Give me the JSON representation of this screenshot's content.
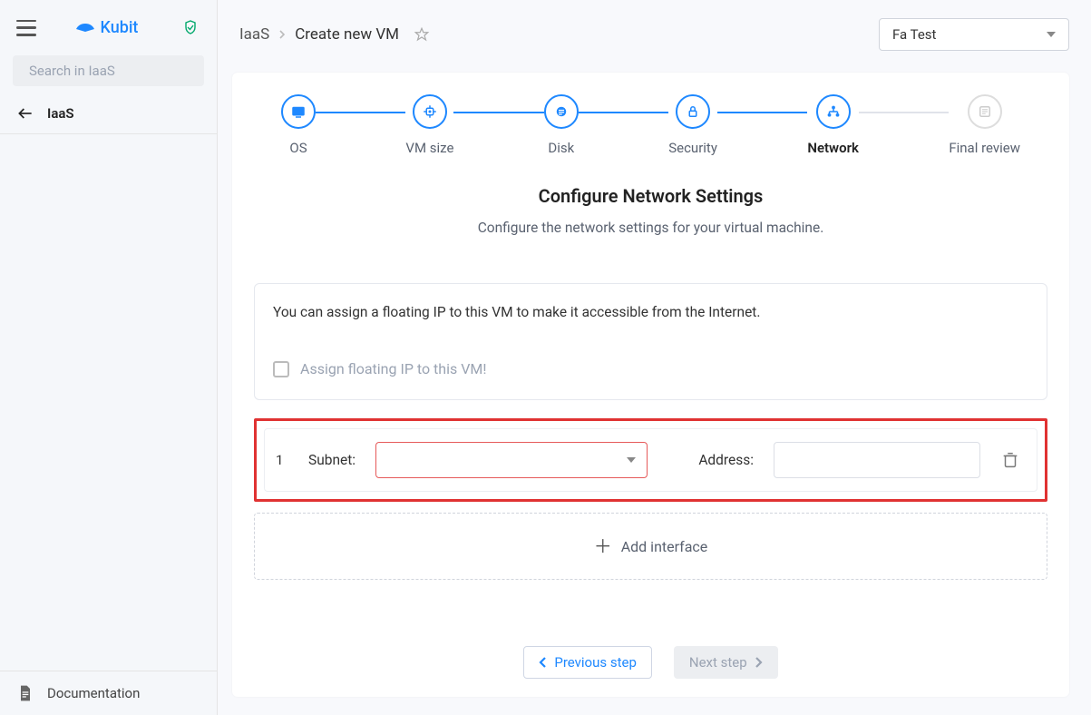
{
  "brand": {
    "name": "Kubit"
  },
  "search": {
    "placeholder": "Search in IaaS"
  },
  "nav": {
    "back_label": "IaaS"
  },
  "sidebar": {
    "documentation": "Documentation"
  },
  "breadcrumb": {
    "root": "IaaS",
    "current": "Create new VM"
  },
  "project_select": {
    "value": "Fa Test"
  },
  "stepper": {
    "steps": [
      {
        "label": "OS"
      },
      {
        "label": "VM size"
      },
      {
        "label": "Disk"
      },
      {
        "label": "Security"
      },
      {
        "label": "Network"
      },
      {
        "label": "Final review"
      }
    ]
  },
  "page": {
    "title": "Configure Network Settings",
    "subtitle": "Configure the network settings for your virtual machine."
  },
  "floating_ip": {
    "info": "You can assign a floating IP to this VM to make it accessible from the Internet.",
    "checkbox_label": "Assign floating IP to this VM!"
  },
  "interface": {
    "index": "1",
    "subnet_label": "Subnet:",
    "address_label": "Address:"
  },
  "add_interface": {
    "label": "Add interface"
  },
  "nav_buttons": {
    "prev": "Previous step",
    "next": "Next step"
  }
}
